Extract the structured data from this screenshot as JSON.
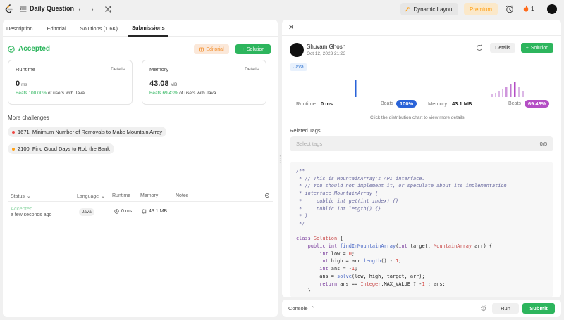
{
  "topbar": {
    "title": "Daily Question",
    "dynamic_layout": "Dynamic Layout",
    "premium": "Premium",
    "streak_count": "1"
  },
  "tabs": [
    {
      "label": "Description"
    },
    {
      "label": "Editorial"
    },
    {
      "label": "Solutions (1.6K)"
    },
    {
      "label": "Submissions"
    }
  ],
  "result": {
    "status": "Accepted",
    "editorial_label": "Editorial",
    "solution_label": "Solution"
  },
  "runtime": {
    "label": "Runtime",
    "details": "Details",
    "value": "0",
    "unit": "ms",
    "beats_prefix": "Beats",
    "beats_pct": "100.00%",
    "beats_suffix": "of users with Java"
  },
  "memory": {
    "label": "Memory",
    "details": "Details",
    "value": "43.08",
    "unit": "MB",
    "beats_prefix": "Beats",
    "beats_pct": "69.43%",
    "beats_suffix": "of users with Java"
  },
  "challenges": {
    "title": "More challenges",
    "items": [
      {
        "label": "1671. Minimum Number of Removals to Make Mountain Array",
        "color": "#ef4743"
      },
      {
        "label": "2100. Find Good Days to Rob the Bank",
        "color": "#ffa116"
      }
    ]
  },
  "table": {
    "headers": {
      "status": "Status",
      "language": "Language",
      "runtime": "Runtime",
      "memory": "Memory",
      "notes": "Notes"
    },
    "rows": [
      {
        "status": "Accepted",
        "time": "a few seconds ago",
        "language": "Java",
        "runtime": "0 ms",
        "memory": "43.1 MB"
      }
    ]
  },
  "detail": {
    "user": "Shuvam Ghosh",
    "date": "Oct 12, 2023 21:23",
    "details_label": "Details",
    "solution_label": "Solution",
    "language": "Java",
    "runtime_label": "Runtime",
    "runtime_value": "0 ms",
    "runtime_beats_label": "Beats",
    "runtime_beats": "100%",
    "memory_label": "Memory",
    "memory_value": "43.1 MB",
    "memory_beats_label": "Beats",
    "memory_beats": "69.43%",
    "hint": "Click the distribution chart to view more details",
    "related_tags": "Related Tags",
    "tags_placeholder": "Select tags",
    "tags_count": "0/5"
  },
  "bottom": {
    "console": "Console",
    "run": "Run",
    "submit": "Submit"
  },
  "colors": {
    "accent_green": "#2db55d",
    "runtime_bar": "#2a63d8",
    "memory_bar": "#b44ec4",
    "memory_bar_light": "#dcb8e6"
  }
}
